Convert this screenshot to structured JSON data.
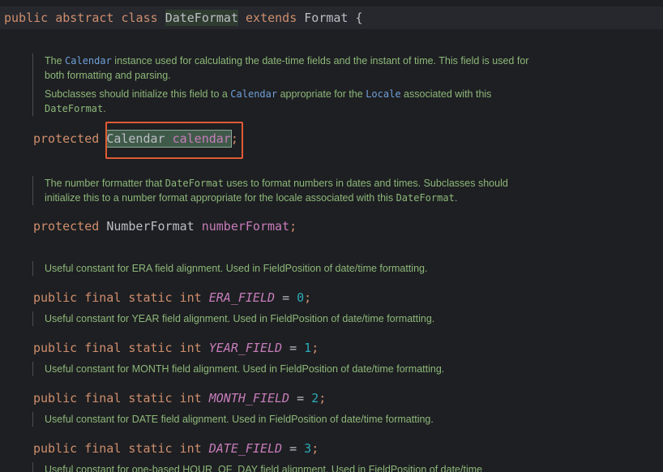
{
  "class_decl": {
    "kw1": "public",
    "kw2": "abstract",
    "kw3": "class",
    "name": "DateFormat",
    "kw4": "extends",
    "parent": "Format",
    "brace": "{"
  },
  "doc_calendar": {
    "p1_a": "The ",
    "p1_link": "Calendar",
    "p1_b": " instance used for calculating the date-time fields and the instant of time. This field is used for both formatting and parsing.",
    "p2_a": "Subclasses should initialize this field to a ",
    "p2_link1": "Calendar",
    "p2_b": " appropriate for the ",
    "p2_link2": "Locale",
    "p2_c": " associated with this ",
    "p2_mono": "DateFormat",
    "p2_d": "."
  },
  "field_calendar": {
    "modifier": "protected",
    "type": "Calendar",
    "name": "calendar",
    "semi": ";"
  },
  "doc_number": {
    "a": "The number formatter that ",
    "mono1": "DateFormat",
    "b": " uses to format numbers in dates and times. Subclasses should initialize this to a number format appropriate for the locale associated with this ",
    "mono2": "DateFormat",
    "c": "."
  },
  "field_number": {
    "modifier": "protected",
    "type": "NumberFormat",
    "name": "numberFormat",
    "semi": ";"
  },
  "constants": [
    {
      "doc": "Useful constant for ERA field alignment. Used in FieldPosition of date/time formatting.",
      "kw1": "public",
      "kw2": "final",
      "kw3": "static",
      "kw4": "int",
      "name": "ERA_FIELD",
      "eq": "=",
      "value": "0",
      "semi": ";"
    },
    {
      "doc": "Useful constant for YEAR field alignment. Used in FieldPosition of date/time formatting.",
      "kw1": "public",
      "kw2": "final",
      "kw3": "static",
      "kw4": "int",
      "name": "YEAR_FIELD",
      "eq": "=",
      "value": "1",
      "semi": ";"
    },
    {
      "doc": "Useful constant for MONTH field alignment. Used in FieldPosition of date/time formatting.",
      "kw1": "public",
      "kw2": "final",
      "kw3": "static",
      "kw4": "int",
      "name": "MONTH_FIELD",
      "eq": "=",
      "value": "2",
      "semi": ";"
    },
    {
      "doc": "Useful constant for DATE field alignment. Used in FieldPosition of date/time formatting.",
      "kw1": "public",
      "kw2": "final",
      "kw3": "static",
      "kw4": "int",
      "name": "DATE_FIELD",
      "eq": "=",
      "value": "3",
      "semi": ";"
    }
  ],
  "doc_hour_partial": "Useful constant for one-based HOUR_OF_DAY field alignment. Used in FieldPosition of date/time",
  "colors": {
    "background": "#1e1f22",
    "keyword": "#cf8e6d",
    "field": "#c77dbb",
    "number": "#2aacb8",
    "doc_text": "#8db87a",
    "doc_link": "#6f9fd8",
    "highlight_box": "#e05a35"
  }
}
